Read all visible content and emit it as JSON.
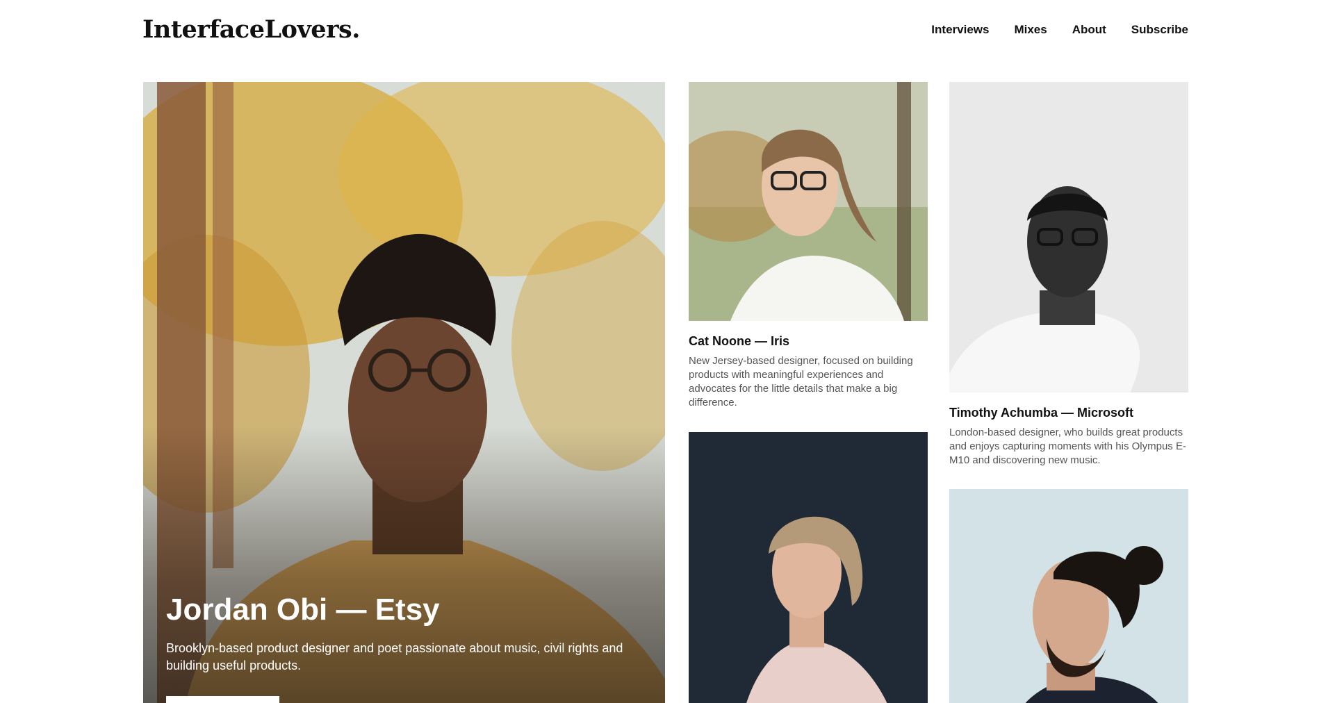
{
  "site": {
    "logo": "InterfaceLovers."
  },
  "nav": {
    "items": [
      "Interviews",
      "Mixes",
      "About",
      "Subscribe"
    ]
  },
  "featured": {
    "title": "Jordan Obi — Etsy",
    "description": "Brooklyn-based product designer and poet passionate about music, civil rights and building useful products.",
    "button_label": ""
  },
  "cards": [
    {
      "title": "Cat Noone — Iris",
      "description": "New Jersey-based designer, focused on building products with meaningful experiences and advocates for the little details that make a big difference."
    },
    {
      "title": "Timothy Achumba — Microsoft",
      "description": "London-based designer, who builds great products and enjoys capturing moments with his Olympus E-M10 and discovering new music."
    },
    {
      "title": "",
      "description": ""
    },
    {
      "title": "",
      "description": ""
    }
  ],
  "colors": {
    "text": "#111111",
    "muted": "#555555",
    "background": "#ffffff"
  }
}
